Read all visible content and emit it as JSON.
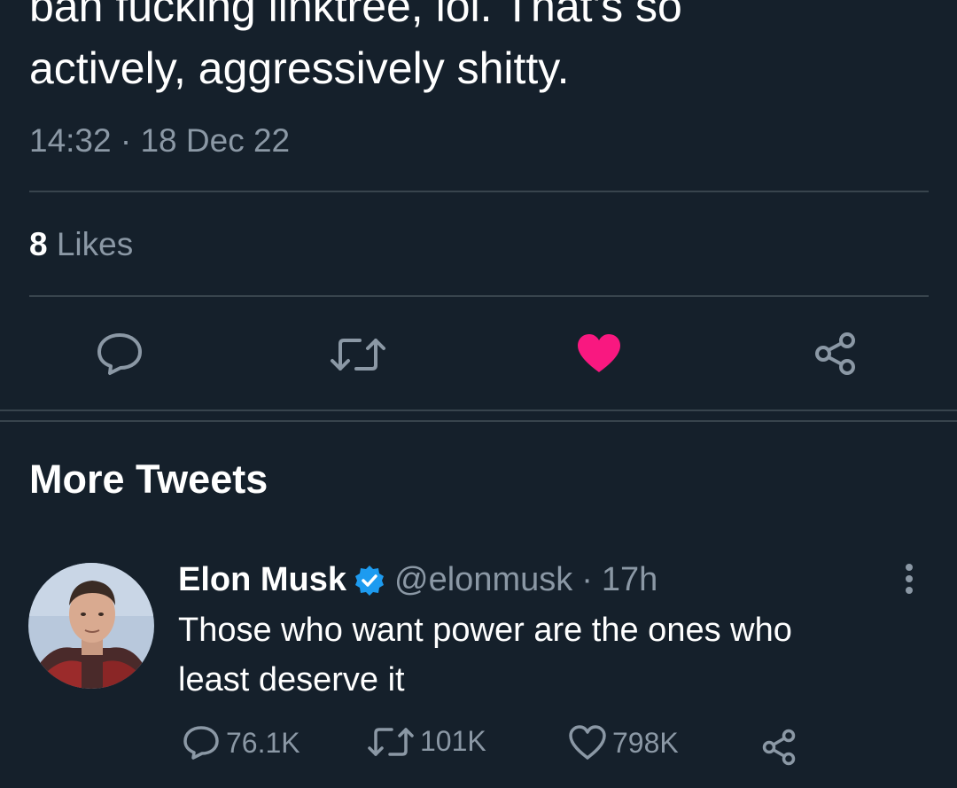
{
  "tweet": {
    "text_line1": "ban fucking linktree, lol. That's so",
    "text_line2": "actively, aggressively shitty.",
    "timestamp": "14:32 · 18 Dec 22",
    "likes_count": "8",
    "likes_label": "Likes",
    "actions": [
      "reply-icon",
      "retweet-icon",
      "liked-heart-icon",
      "share-icon"
    ],
    "liked": true,
    "like_color": "#f91880"
  },
  "more_tweets": {
    "title": "More Tweets",
    "items": [
      {
        "author_name": "Elon Musk",
        "verified": true,
        "handle": "@elonmusk",
        "separator": "·",
        "time_ago": "17h",
        "text_line1": "Those who want power are the ones who",
        "text_line2": "least deserve it",
        "replies": "76.1K",
        "retweets": "101K",
        "likes": "798K"
      }
    ]
  },
  "colors": {
    "background": "#15202b",
    "text_primary": "#ffffff",
    "text_secondary": "#8b98a5",
    "divider": "#38444d",
    "verified_badge": "#1d9bf0"
  }
}
